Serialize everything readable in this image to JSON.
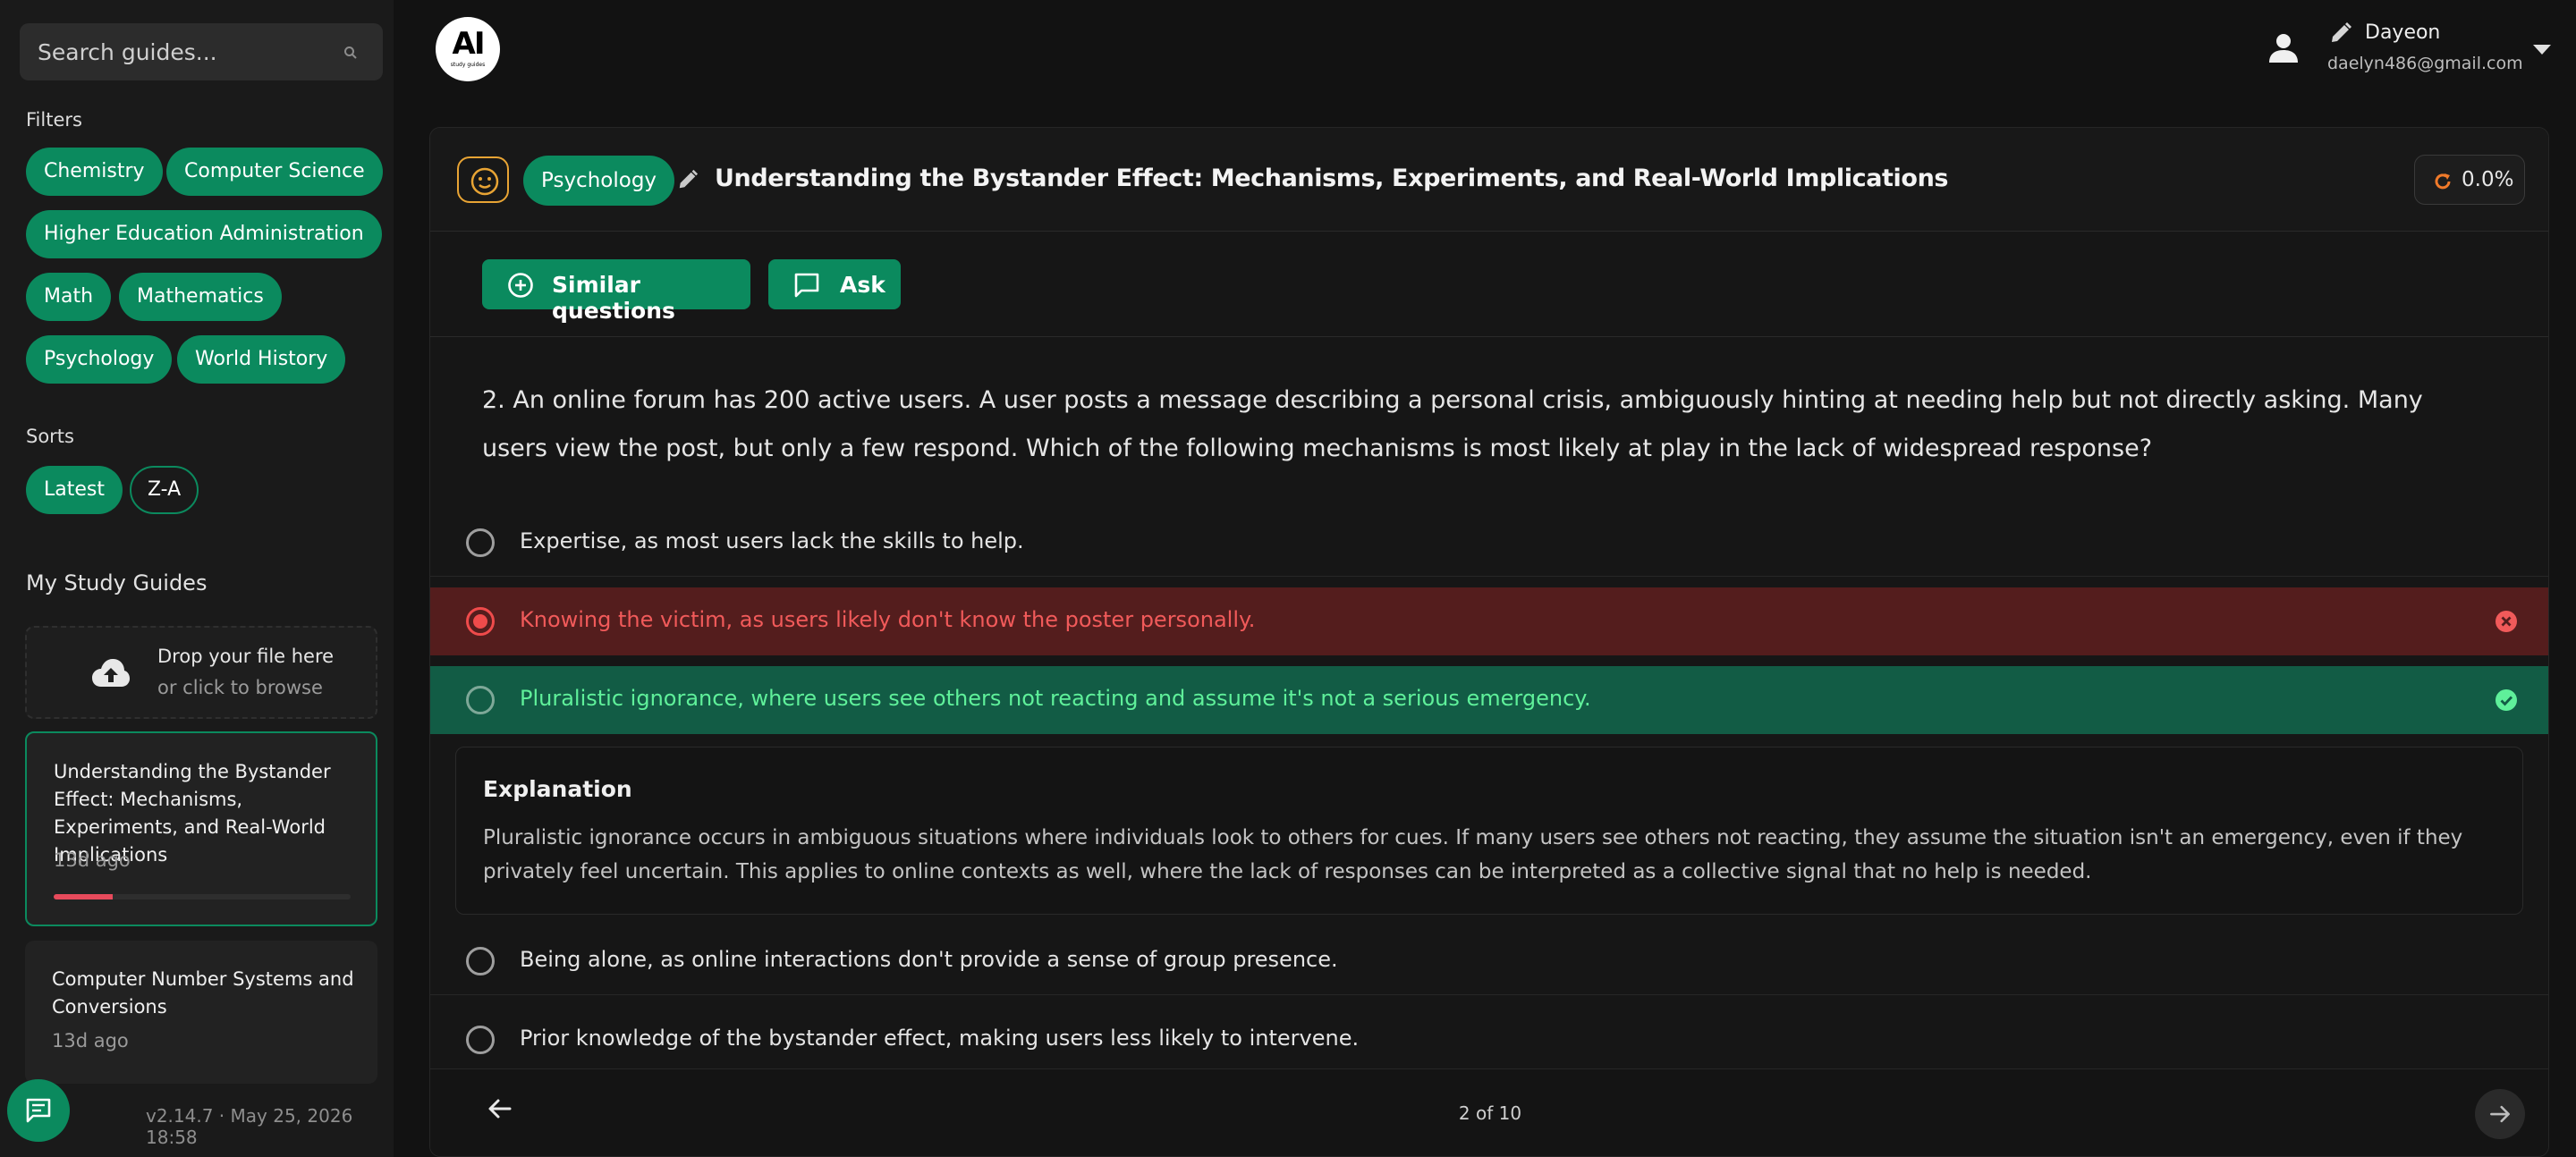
{
  "sidebar": {
    "search_placeholder": "Search guides...",
    "filters_label": "Filters",
    "filters": [
      "Chemistry",
      "Computer Science",
      "Higher Education Administration",
      "Math",
      "Mathematics",
      "Psychology",
      "World History"
    ],
    "sorts_label": "Sorts",
    "sorts": [
      "Latest",
      "Z-A"
    ],
    "my_study_guides_label": "My Study Guides",
    "dropzone": {
      "line1": "Drop your file here",
      "line2": "or click to browse"
    },
    "guides": [
      {
        "title": "Understanding the Bystander Effect: Mechanisms, Experiments, and Real-World Implications",
        "age": "13d ago",
        "progress": 0.2
      },
      {
        "title": "Computer Number Systems and Conversions",
        "age": "13d ago"
      }
    ],
    "version": "v2.14.7 · May 25, 2026 18:58"
  },
  "header": {
    "logo_text": "AI",
    "logo_subtext": "study guides",
    "user_name": "Dayeon",
    "user_email": "daelyn486@gmail.com"
  },
  "guide": {
    "topic": "Psychology",
    "title": "Understanding the Bystander Effect: Mechanisms, Experiments, and Real-World Implications",
    "progress": "0.0%"
  },
  "actions": {
    "similar": "Similar questions",
    "ask": "Ask"
  },
  "question": {
    "text": "2. An online forum has 200 active users. A user posts a message describing a personal crisis, ambiguously hinting at needing help but not directly asking. Many users view the post, but only a few respond. Which of the following mechanisms is most likely at play in the lack of widespread response?",
    "options": [
      "Expertise, as most users lack the skills to help.",
      "Knowing the victim, as users likely don't know the poster personally.",
      "Pluralistic ignorance, where users see others not reacting and assume it's not a serious emergency.",
      "Being alone, as online interactions don't provide a sense of group presence.",
      "Prior knowledge of the bystander effect, making users less likely to intervene."
    ],
    "selected_index": 1,
    "correct_index": 2,
    "explanation_title": "Explanation",
    "explanation": "Pluralistic ignorance occurs in ambiguous situations where individuals look to others for cues. If many users see others not reacting, they assume the situation isn't an emergency, even if they privately feel uncertain. This applies to online contexts as well, where the lack of responses can be interpreted as a collective signal that no help is needed."
  },
  "pagination": {
    "label": "2 of 10"
  },
  "colors": {
    "accent": "#0b8a5e",
    "wrong_bg": "#541d1d",
    "wrong_text": "#f15a5a",
    "right_bg": "#125c45",
    "right_text": "#5ff09a",
    "warning": "#e8a434"
  }
}
